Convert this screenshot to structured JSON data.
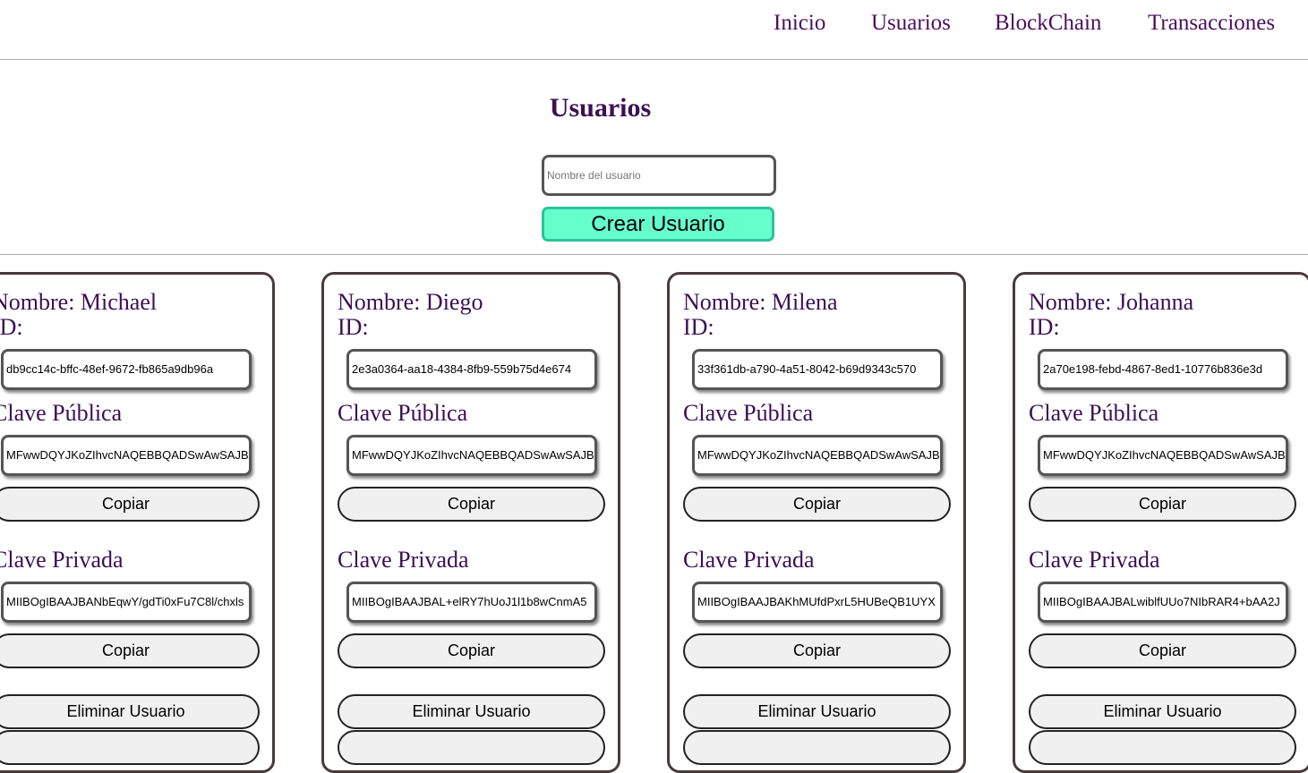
{
  "nav": {
    "items": [
      "Inicio",
      "Usuarios",
      "BlockChain",
      "Transacciones"
    ]
  },
  "page": {
    "title": "Usuarios",
    "name_placeholder": "Nombre del usuario",
    "create_label": "Crear Usuario"
  },
  "card_labels": {
    "name_prefix": "Nombre:",
    "id": "ID:",
    "public_key": "Clave Pública",
    "private_key": "Clave Privada",
    "copy": "Copiar",
    "delete": "Eliminar Usuario"
  },
  "users": [
    {
      "name": "Nombre: Michael",
      "id": "db9cc14c-bffc-48ef-9672-fb865a9db96a",
      "public_key": "MFwwDQYJKoZIhvcNAQEBBQADSwAwSAJBA",
      "private_key": "MIIBOgIBAAJBANbEqwY/gdTi0xFu7C8l/chxls"
    },
    {
      "name": "Nombre: Diego",
      "id": "2e3a0364-aa18-4384-8fb9-559b75d4e674",
      "public_key": "MFwwDQYJKoZIhvcNAQEBBQADSwAwSAJBA",
      "private_key": "MIIBOgIBAAJBAL+elRY7hUoJ1l1b8wCnmA5"
    },
    {
      "name": "Nombre: Milena",
      "id": "33f361db-a790-4a51-8042-b69d9343c570",
      "public_key": "MFwwDQYJKoZIhvcNAQEBBQADSwAwSAJBA",
      "private_key": "MIIBOgIBAAJBAKhMUfdPxrL5HUBeQB1UYX"
    },
    {
      "name": "Nombre: Johanna",
      "id": "2a70e198-febd-4867-8ed1-10776b836e3d",
      "public_key": "MFwwDQYJKoZIhvcNAQEBBQADSwAwSAJBA",
      "private_key": "MIIBOgIBAAJBALwiblfUUo7NIbRAR4+bAA2J"
    }
  ]
}
